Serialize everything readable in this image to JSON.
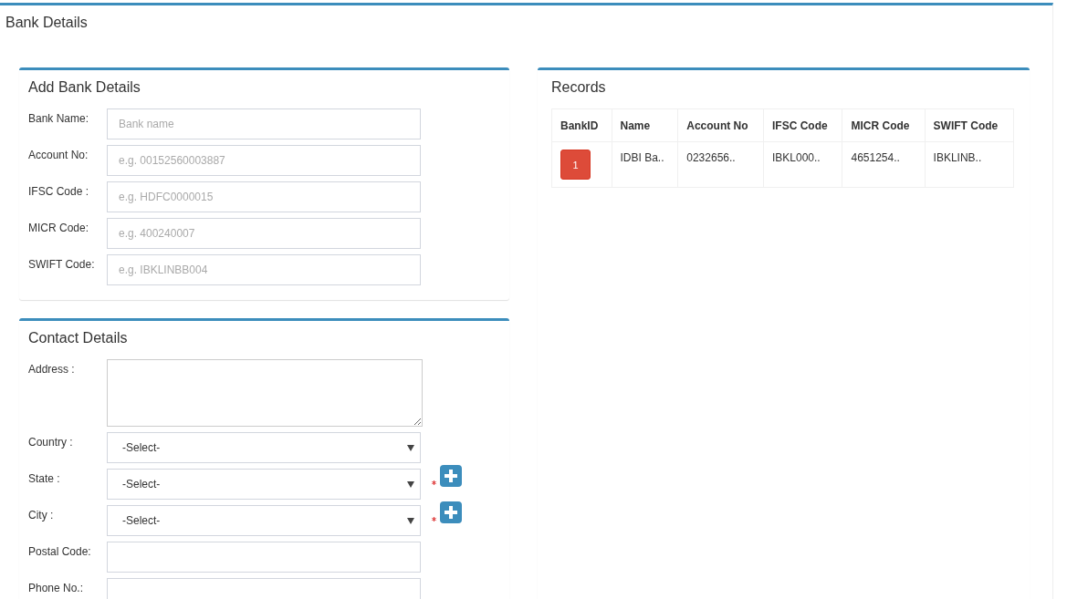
{
  "page": {
    "title": "Bank Details"
  },
  "bank_form": {
    "title": "Add Bank Details",
    "fields": [
      {
        "label": "Bank Name:",
        "placeholder": "Bank name"
      },
      {
        "label": "Account No:",
        "placeholder": "e.g. 00152560003887"
      },
      {
        "label": "IFSC Code :",
        "placeholder": "e.g. HDFC0000015"
      },
      {
        "label": "MICR Code:",
        "placeholder": "e.g. 400240007"
      },
      {
        "label": "SWIFT Code:",
        "placeholder": "e.g. IBKLINBB004"
      }
    ]
  },
  "contact_form": {
    "title": "Contact Details",
    "fields": [
      {
        "kind": "textarea",
        "label": "Address :"
      },
      {
        "kind": "select",
        "label": "Country :",
        "value": "-Select-",
        "required": false
      },
      {
        "kind": "select",
        "label": "State :",
        "value": "-Select-",
        "required": true
      },
      {
        "kind": "select",
        "label": "City :",
        "value": "-Select-",
        "required": true
      },
      {
        "kind": "text",
        "label": "Postal Code:"
      },
      {
        "kind": "text",
        "label": "Phone No.:"
      }
    ]
  },
  "records": {
    "title": "Records",
    "columns": [
      "BankID",
      "Name",
      "Account No",
      "IFSC Code",
      "MICR Code",
      "SWIFT Code"
    ],
    "rows": [
      {
        "cells": [
          "1",
          "IDBI Ba..",
          "0232656..",
          "IBKL000..",
          "4651254..",
          "IBKLINB.."
        ]
      }
    ]
  }
}
